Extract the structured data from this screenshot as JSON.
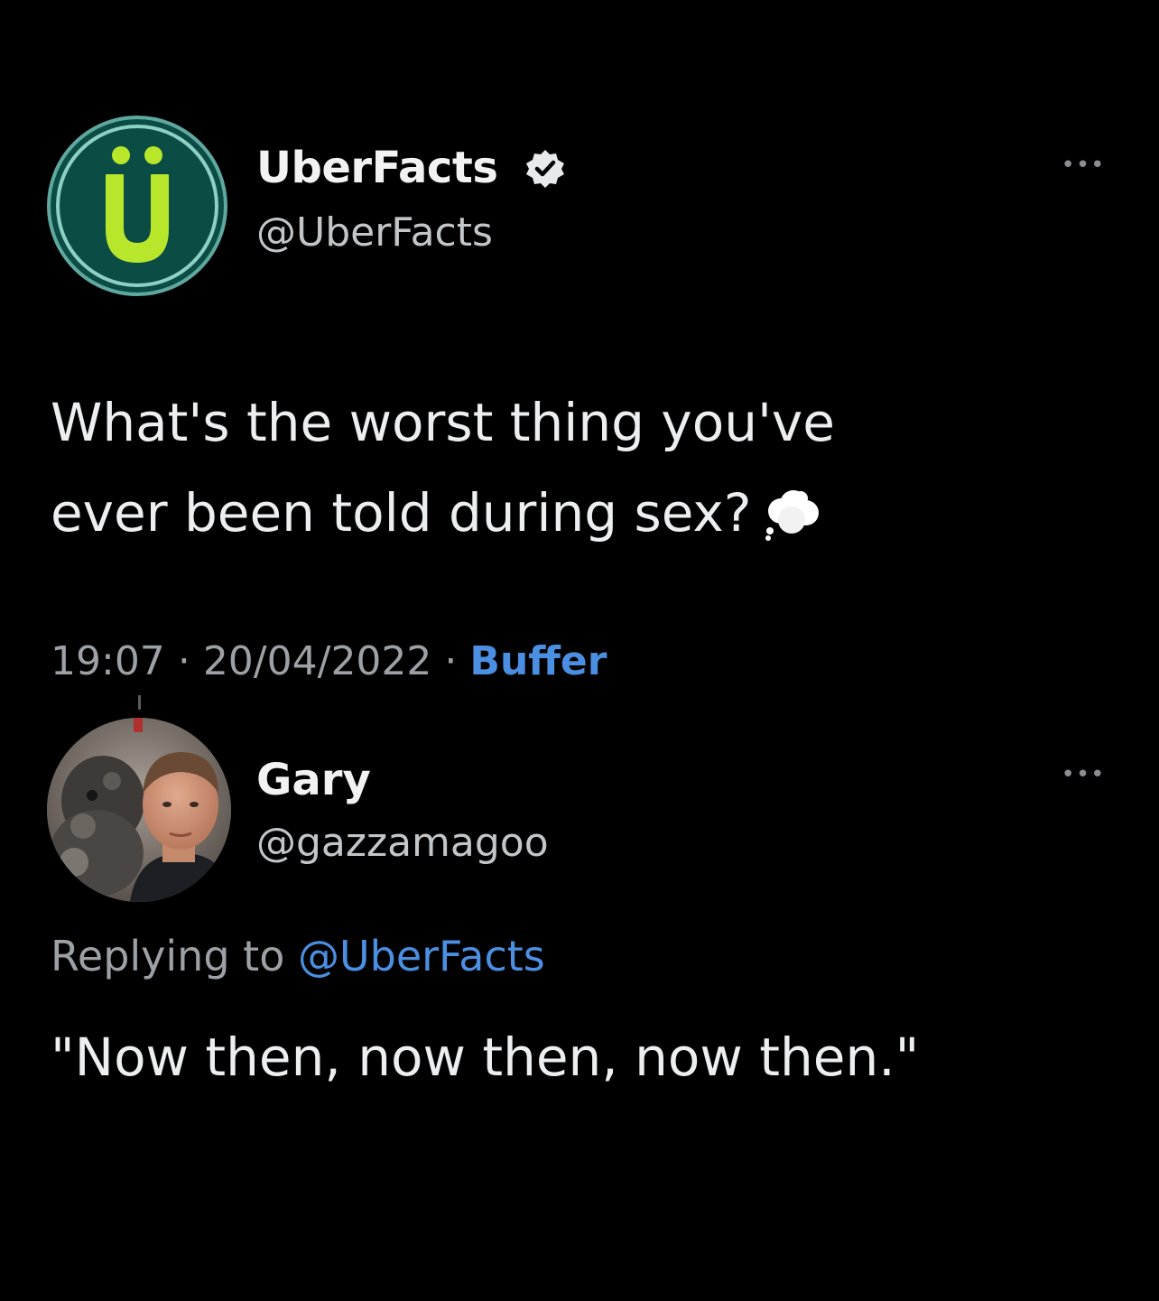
{
  "colors": {
    "background": "#000000",
    "text": "#eceeef",
    "secondary_text": "#9da1a6",
    "link": "#4b8fe2",
    "avatar_ring": "#0b4c44",
    "logo_green": "#b7e62b",
    "verified_fill": "#e7e9ea"
  },
  "tweet": {
    "author_name": "UberFacts",
    "author_handle": "@UberFacts",
    "avatar_icon": "uberfacts-logo-icon",
    "verified_icon": "verified-badge-icon",
    "more_icon": "more-options-icon",
    "more_label": "•••",
    "text_line1": "What's the worst thing you've",
    "text_line2": "ever been told during sex?",
    "emoji": "cloud-emoji-icon",
    "time": "19:07",
    "date": "20/04/2022",
    "separator": "·",
    "source": "Buffer"
  },
  "reply": {
    "author_name": "Gary",
    "author_handle": "@gazzamagoo",
    "avatar_icon": "profile-photo",
    "more_icon": "more-options-icon",
    "more_label": "•••",
    "replying_prefix": "Replying to",
    "replying_mention": "@UberFacts",
    "text": "\"Now then, now then, now then.\""
  }
}
